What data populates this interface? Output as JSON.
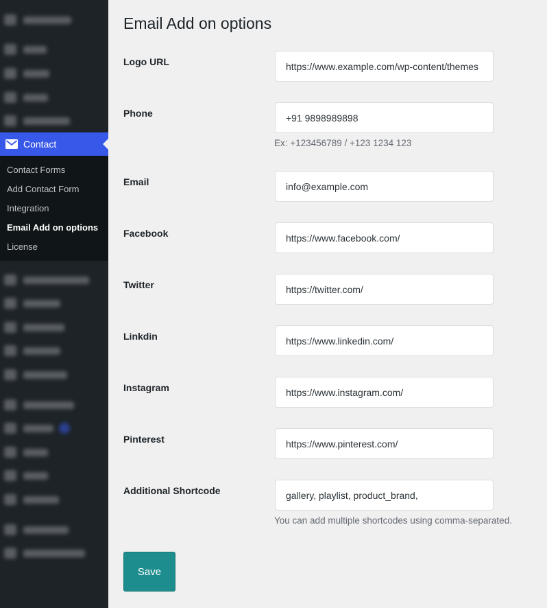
{
  "sidebar": {
    "active_menu": {
      "label": "Contact",
      "icon": "mail-icon"
    },
    "submenu": [
      {
        "label": "Contact Forms",
        "current": false
      },
      {
        "label": "Add Contact Form",
        "current": false
      },
      {
        "label": "Integration",
        "current": false
      },
      {
        "label": "Email Add on options",
        "current": true
      },
      {
        "label": "License",
        "current": false
      }
    ]
  },
  "page": {
    "title": "Email Add on options"
  },
  "fields": {
    "logo_url": {
      "label": "Logo URL",
      "value": "https://www.example.com/wp-content/themes"
    },
    "phone": {
      "label": "Phone",
      "value": "+91 9898989898",
      "hint": "Ex: +123456789 / +123 1234 123"
    },
    "email": {
      "label": "Email",
      "value": "info@example.com"
    },
    "facebook": {
      "label": "Facebook",
      "value": "https://www.facebook.com/"
    },
    "twitter": {
      "label": "Twitter",
      "value": "https://twitter.com/"
    },
    "linkedin": {
      "label": "Linkdin",
      "value": "https://www.linkedin.com/"
    },
    "instagram": {
      "label": "Instagram",
      "value": "https://www.instagram.com/"
    },
    "pinterest": {
      "label": "Pinterest",
      "value": "https://www.pinterest.com/"
    },
    "shortcode": {
      "label": "Additional Shortcode",
      "value": "gallery, playlist, product_brand,",
      "hint": "You can add multiple shortcodes using comma-separated."
    }
  },
  "actions": {
    "save_label": "Save"
  },
  "colors": {
    "accent": "#3858e9",
    "sidebar_bg": "#1d2327",
    "submenu_bg": "#101517",
    "save_button": "#1d8e8d"
  }
}
